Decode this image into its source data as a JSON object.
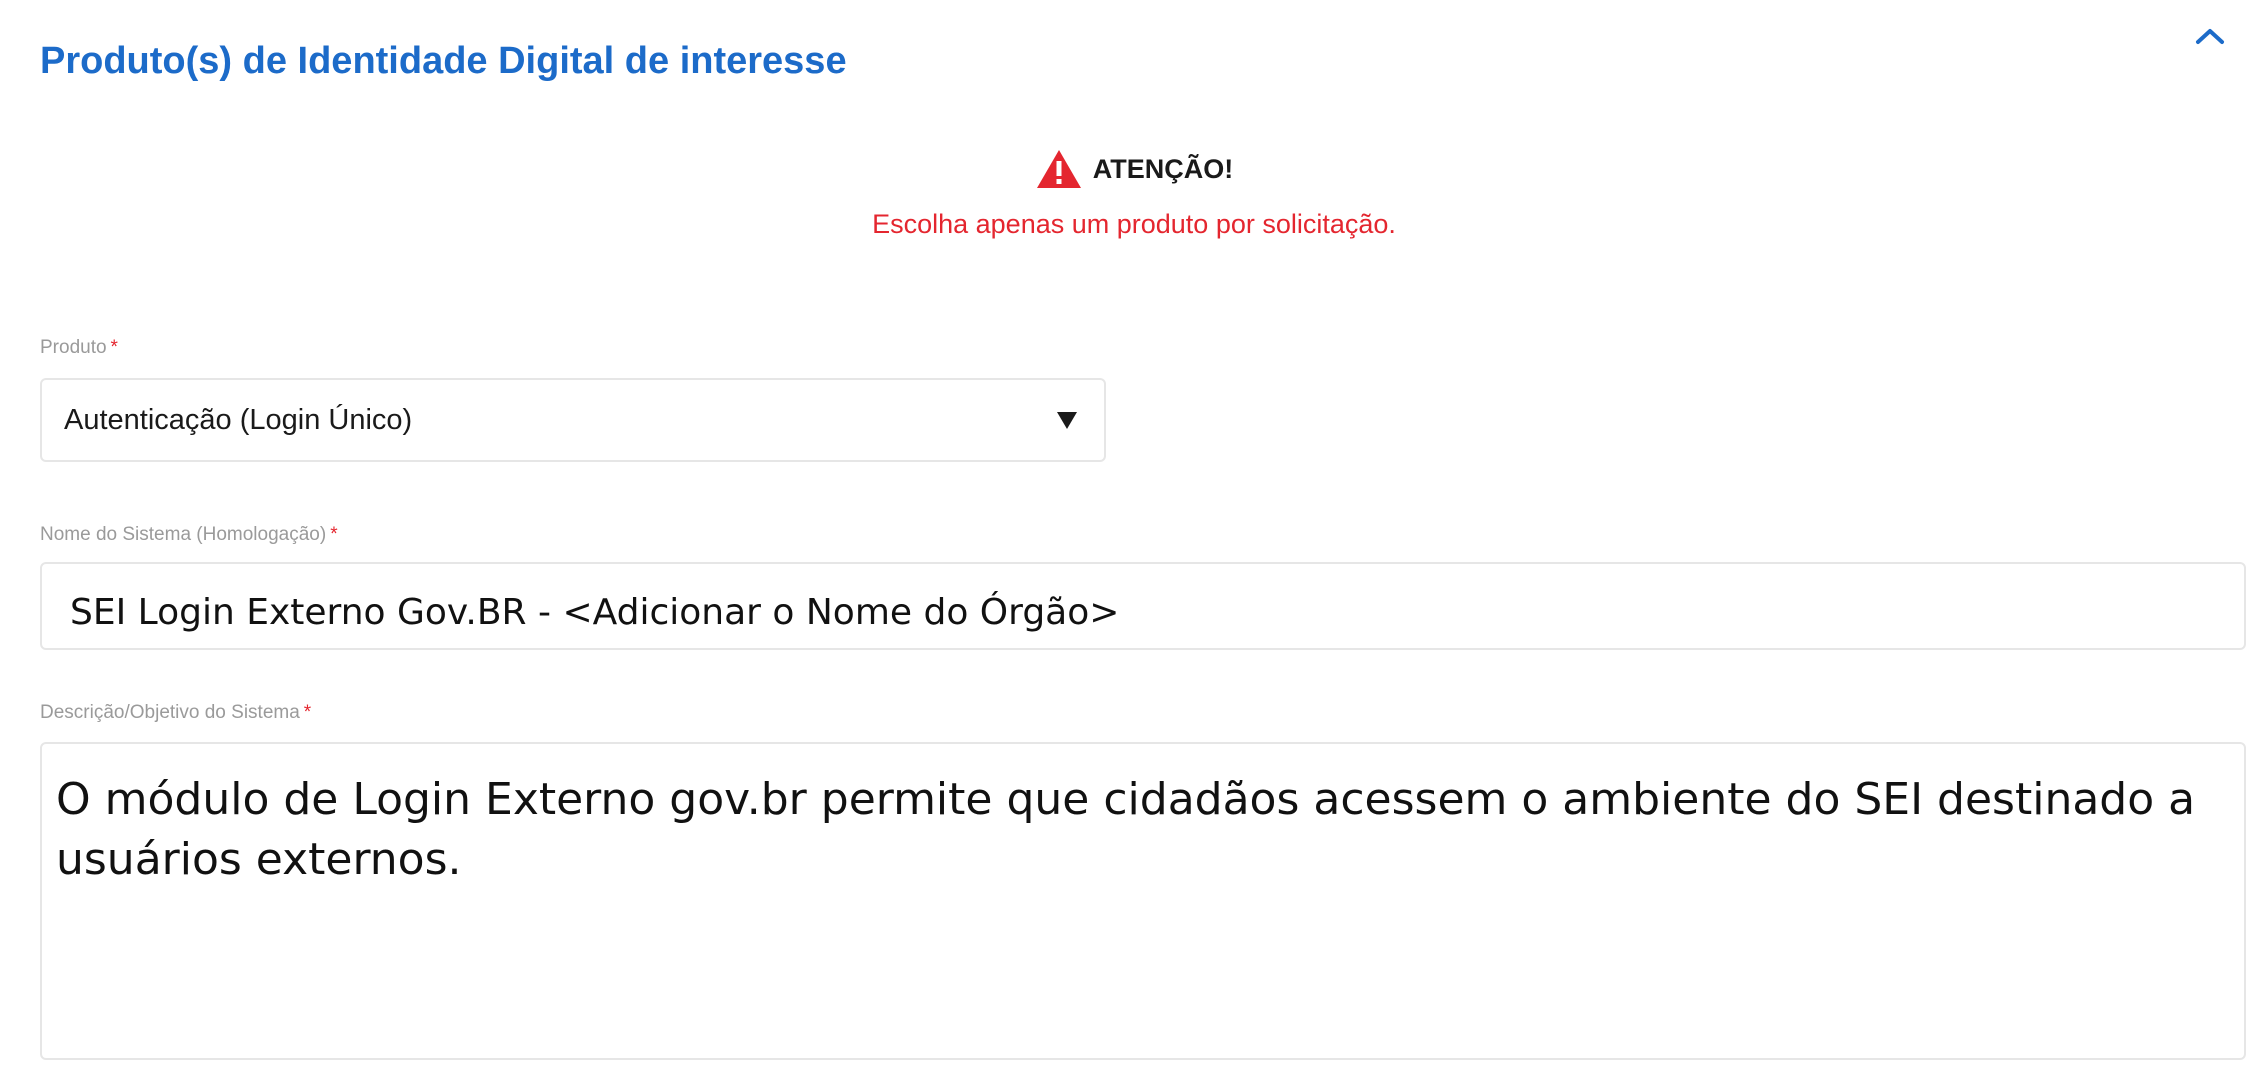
{
  "section": {
    "title": "Produto(s) de Identidade Digital de interesse",
    "collapse_icon": "chevron-up-icon"
  },
  "warning": {
    "icon": "warning-triangle-icon",
    "title": "ATENÇÃO!",
    "message": "Escolha apenas um produto por solicitação."
  },
  "fields": {
    "product": {
      "label": "Produto",
      "required_mark": "*",
      "selected_value": "Autenticação (Login Único)",
      "caret_icon": "dropdown-caret-icon"
    },
    "system_name": {
      "label": "Nome do Sistema (Homologação)",
      "required_mark": "*",
      "value": "SEI Login Externo Gov.BR - <Adicionar o Nome do Órgão>"
    },
    "description": {
      "label": "Descrição/Objetivo do Sistema",
      "required_mark": "*",
      "value": "O módulo de Login Externo gov.br permite que cidadãos acessem o ambiente do SEI destinado a usuários externos."
    }
  },
  "colors": {
    "title_blue": "#1c6bc9",
    "warning_red": "#e4262f",
    "label_gray": "#9a9a9a",
    "border_gray": "#e6e6e6"
  }
}
